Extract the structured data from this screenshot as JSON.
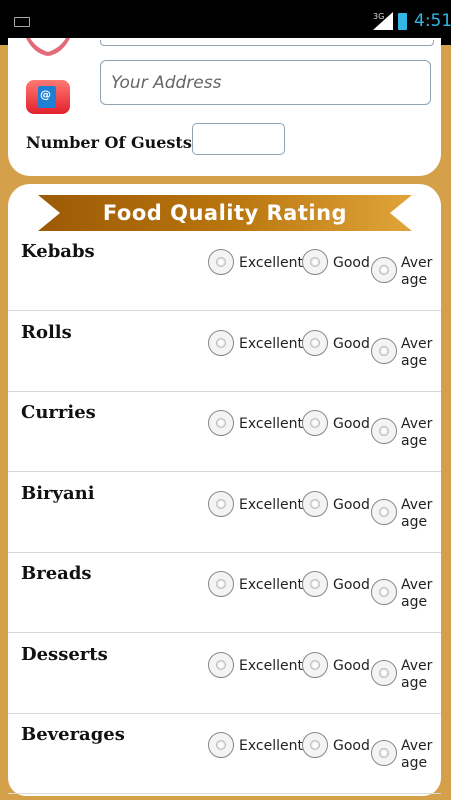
{
  "status_bar": {
    "time": "4:51",
    "network": "3G"
  },
  "form": {
    "address_placeholder": "Your Address",
    "guests_label": "Number Of Guests",
    "guests_value": ""
  },
  "rating_section": {
    "title": "Food Quality Rating",
    "options": [
      "Excellent",
      "Good",
      "Average"
    ],
    "items": [
      {
        "name": "Kebabs"
      },
      {
        "name": "Rolls"
      },
      {
        "name": "Curries"
      },
      {
        "name": "Biryani"
      },
      {
        "name": "Breads"
      },
      {
        "name": "Desserts"
      },
      {
        "name": "Beverages"
      }
    ]
  },
  "colors": {
    "page_bg": "#d4a04a",
    "banner": "#b86f0c",
    "accent": "#33b5e5"
  },
  "icons": {
    "address": "address-book-icon",
    "contact": "heart-icon"
  }
}
